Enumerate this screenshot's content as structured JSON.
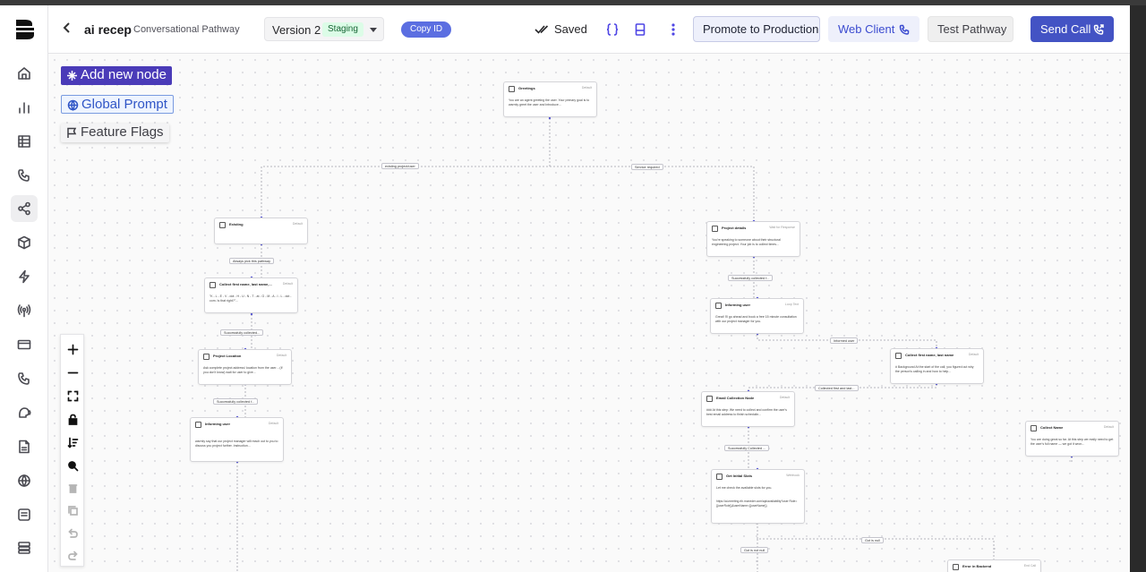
{
  "header": {
    "title": "ai recep",
    "subtitle": "Conversational Pathway",
    "version_label": "Version 2",
    "version_badge": "Staging",
    "copy_id": "Copy ID",
    "saved": "Saved",
    "promote": "Promote to Production",
    "web_client": "Web Client",
    "test_pathway": "Test Pathway",
    "send_call": "Send Call"
  },
  "canvas_actions": {
    "add_node": "Add new node",
    "global_prompt": "Global Prompt",
    "feature_flags": "Feature Flags"
  },
  "nodes": [
    {
      "title": "Greetings",
      "tag": "Default",
      "body": "You are an agent greeting the user. Your primary goal is to warmly greet the user and introduce..."
    },
    {
      "title": "Existing",
      "tag": "Default",
      "body": ""
    },
    {
      "title": "Collect first name, last name,...",
      "tag": "Default",
      "body": "\"K - L - E - V - dot - H - U - N - T - at - G - M - A - I - L - dot - com. Is that right?\"..."
    },
    {
      "title": "Project Location",
      "tag": "Default",
      "body": "Ask complete project address/ location from the user. - (If you don't know) wait for user to give..."
    },
    {
      "title": "Informing user",
      "tag": "Default",
      "body": "warmly say that our project manager will reach out to you to discuss you project further. Instruction..."
    },
    {
      "title": "Project details",
      "tag": "Wait for Response",
      "body": "You're speaking to someone about their structural engineering project. Your job is to collect times..."
    },
    {
      "title": "Informing user",
      "tag": "Loop Text",
      "body": "Great! I'll go ahead and book a free 15 minute consultation with our project manager for you."
    },
    {
      "title": "Collect first name, last name",
      "tag": "Default",
      "body": "# Background At the start of the call, you figured out why the person's calling in and how to help..."
    },
    {
      "title": "Email Collection Node",
      "tag": "Default",
      "body": "### At this step: We need to collect and confirm the user's best email address to finish schedulin..."
    },
    {
      "title": "Get Initial Slots",
      "tag": "Webhook",
      "body": "Let me check the available slots for you.",
      "body2": "https://ai-meeting.rth.moneder.com/api/availability?user Role={{userRole}}&userName={{userName}}"
    },
    {
      "title": "Collect Name",
      "tag": "Default",
      "body": "You are doing great so far. At this step we really need to get the user's full name — we got it wron..."
    },
    {
      "title": "Error in Backend",
      "tag": "End Call",
      "body": ""
    }
  ],
  "edge_labels": [
    "existing project/user",
    "Service required",
    "Always pick this pathway",
    "Successfully collected...",
    "Successfully collected f...",
    "Successfully collected f...",
    "Successfully collected ...",
    "Informed user",
    "Collected first and last...",
    "Successfully Collected ...",
    "Got is not null",
    "Got is null"
  ]
}
